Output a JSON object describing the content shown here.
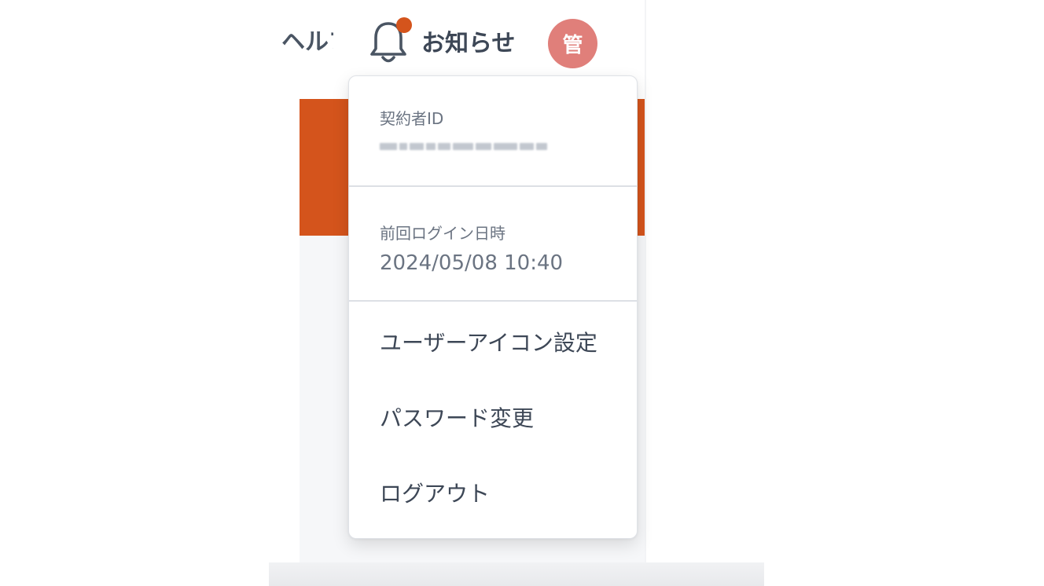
{
  "header": {
    "help_label": "ヘルプ",
    "notice_label": "お知らせ",
    "avatar_initial": "管"
  },
  "menu": {
    "contract_id_label": "契約者ID",
    "contract_id_value": "",
    "last_login_label": "前回ログイン日時",
    "last_login_value": "2024/05/08 10:40",
    "items": [
      {
        "label": "ユーザーアイコン設定"
      },
      {
        "label": "パスワード変更"
      },
      {
        "label": "ログアウト"
      }
    ]
  },
  "colors": {
    "accent": "#d4541c",
    "avatar_bg": "#e07f7a",
    "text_primary": "#3d4756",
    "text_muted": "#6b7482"
  },
  "icons": [
    "bell-icon",
    "notification-dot-icon"
  ]
}
